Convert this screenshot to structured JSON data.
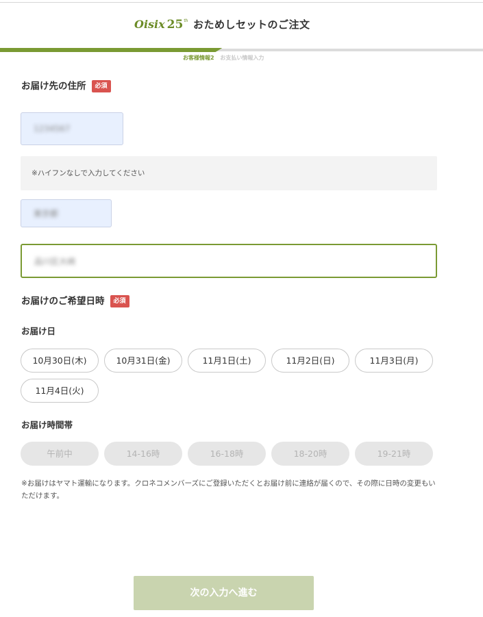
{
  "header": {
    "logo_text": "Oisix",
    "logo_number": "25",
    "logo_suffix": "th",
    "title": "おためしセットのご注文"
  },
  "progress": {
    "fraction": 0.46,
    "steps": [
      {
        "label": "お客様情報2",
        "active": true
      },
      {
        "label": "お支払い情報入力",
        "active": false
      }
    ]
  },
  "address": {
    "title": "お届け先の住所",
    "required_label": "必須",
    "postal_code_value": "1234567",
    "hint": "※ハイフンなしで入力してください",
    "prefecture_value": "東京都",
    "street_value": "品川区大崎"
  },
  "delivery": {
    "title": "お届けのご希望日時",
    "required_label": "必須",
    "date_label": "お届け日",
    "dates": [
      "10月30日(木)",
      "10月31日(金)",
      "11月1日(土)",
      "11月2日(日)",
      "11月3日(月)",
      "11月4日(火)"
    ],
    "time_label": "お届け時間帯",
    "times": [
      "午前中",
      "14-16時",
      "16-18時",
      "18-20時",
      "19-21時"
    ],
    "note": "※お届けはヤマト運輸になります。クロネコメンバーズにご登録いただくとお届け前に連絡が届くので、その際に日時の変更もいただけます。"
  },
  "footer": {
    "next_button_label": "次の入力へ進む"
  },
  "colors": {
    "brand_green": "#7a9a33",
    "required_red": "#d9534f",
    "autofill_blue": "#e8f0fe",
    "disabled_button": "#c9d4af"
  }
}
